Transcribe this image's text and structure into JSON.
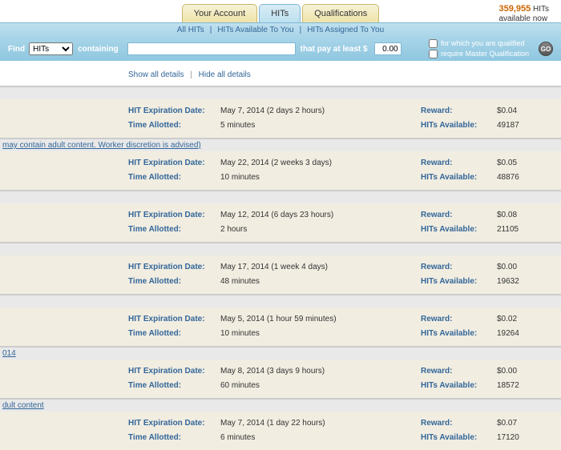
{
  "tabs": {
    "yourAccount": "Your Account",
    "hits": "HITs",
    "quals": "Qualifications"
  },
  "stats": {
    "count": "359,955",
    "unit": "HITs",
    "line2": "available now"
  },
  "subnav": {
    "all": "All HITs",
    "avail": "HITs Available To You",
    "assigned": "HITs Assigned To You"
  },
  "search": {
    "find": "Find",
    "containing": "containing",
    "payAtLeast": "that pay at least $",
    "payVal": "0.00",
    "qualChk": "for which you are qualified",
    "masterChk": "require Master Qualification",
    "go": "GO",
    "options": [
      "HITs"
    ]
  },
  "toggle": {
    "show": "Show all details",
    "hide": "Hide all details"
  },
  "labels": {
    "exp": "HIT Expiration Date:",
    "time": "Time Allotted:",
    "reward": "Reward:",
    "avail": "HITs Available:"
  },
  "items": [
    {
      "title": "",
      "exp": "May 7, 2014  (2 days 2 hours)",
      "time": "5 minutes",
      "reward": "$0.04",
      "avail": "49187"
    },
    {
      "title": "may contain adult content. Worker discretion is advised)",
      "exp": "May 22, 2014  (2 weeks 3 days)",
      "time": "10 minutes",
      "reward": "$0.05",
      "avail": "48876"
    },
    {
      "title": "",
      "exp": "May 12, 2014  (6 days 23 hours)",
      "time": "2 hours",
      "reward": "$0.08",
      "avail": "21105"
    },
    {
      "title": "",
      "exp": "May 17, 2014  (1 week 4 days)",
      "time": "48 minutes",
      "reward": "$0.00",
      "avail": "19632"
    },
    {
      "title": "",
      "exp": "May 5, 2014  (1 hour 59 minutes)",
      "time": "10 minutes",
      "reward": "$0.02",
      "avail": "19264"
    },
    {
      "title": "014",
      "exp": "May 8, 2014  (3 days 9 hours)",
      "time": "60 minutes",
      "reward": "$0.00",
      "avail": "18572"
    },
    {
      "title": "dult content",
      "exp": "May 7, 2014  (1 day 22 hours)",
      "time": "6 minutes",
      "reward": "$0.07",
      "avail": "17120"
    }
  ]
}
